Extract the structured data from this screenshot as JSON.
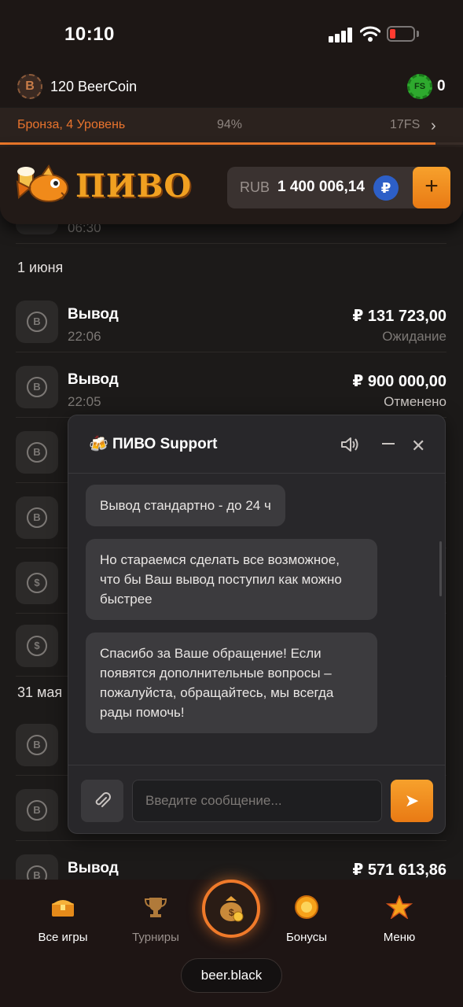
{
  "status_bar": {
    "time": "10:10"
  },
  "coin_bar": {
    "coin_symbol": "B",
    "coin_text": "120 BeerCoin",
    "fs_badge": "FS",
    "fs_count": "0"
  },
  "level": {
    "name": "Бронза, 4 Уровень",
    "percent": "94%",
    "progress": 0.94,
    "fs": "17FS"
  },
  "header": {
    "logo_text": "ПИВО",
    "currency": "RUB",
    "balance": "1 400 006,14",
    "rub_symbol": "₽",
    "add_label": "+"
  },
  "transactions": {
    "top_partial_time": "06:30",
    "date_1": "1 июня",
    "rows": [
      {
        "title": "Вывод",
        "time": "22:06",
        "amount": "₽ 131 723,00",
        "status": "Ожидание"
      },
      {
        "title": "Вывод",
        "time": "22:05",
        "amount": "₽ 900 000,00",
        "status": "Отменено"
      }
    ],
    "date_2": "31 мая",
    "last_row": {
      "title": "Вывод",
      "amount": "₽ 571 613,86"
    }
  },
  "chat": {
    "title_icon": "🍻",
    "title": "ПИВО Support",
    "messages": [
      "Вывод стандартно - до 24 ч",
      "Но стараемся сделать все возможное, что бы Ваш вывод поступил как можно быстрее",
      "Спасибо за Ваше обращение! Если появятся дополнительные вопросы – пожалуйста, обращайтесь, мы всегда рады помочь!"
    ],
    "input_placeholder": "Введите сообщение...",
    "send_icon": "➤",
    "attach_icon": "paperclip-icon",
    "close_glyph": "✕"
  },
  "bottom_nav": {
    "items": [
      {
        "label": "Все игры"
      },
      {
        "label": "Турниры"
      },
      {
        "label": "Бонусы"
      },
      {
        "label": "Меню"
      }
    ],
    "domain": "beer.black"
  },
  "colors": {
    "accent": "#f07a2a",
    "background": "#1c1a19",
    "rub_blue": "#2d5fc7"
  }
}
